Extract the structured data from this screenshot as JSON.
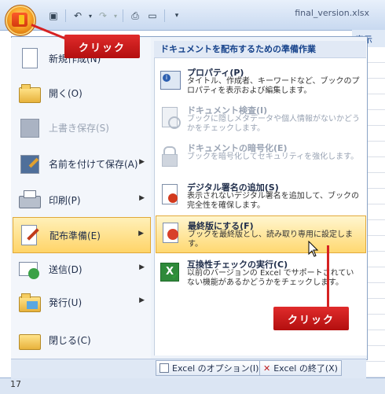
{
  "window": {
    "filename": "final_version.xlsx",
    "ribbon_tab_visible": "表示",
    "row_number": "17"
  },
  "left_menu": [
    {
      "label": "新規作成(N)",
      "icon": "new-document-icon",
      "has_arrow": false,
      "disabled": false
    },
    {
      "label": "開く(O)",
      "icon": "open-folder-icon",
      "has_arrow": false,
      "disabled": false
    },
    {
      "label": "上書き保存(S)",
      "icon": "save-icon",
      "has_arrow": false,
      "disabled": true
    },
    {
      "label": "名前を付けて保存(A)",
      "icon": "save-as-icon",
      "has_arrow": true,
      "disabled": false
    },
    {
      "label": "印刷(P)",
      "icon": "printer-icon",
      "has_arrow": true,
      "disabled": false
    },
    {
      "label": "配布準備(E)",
      "icon": "prepare-icon",
      "has_arrow": true,
      "disabled": false,
      "active": true
    },
    {
      "label": "送信(D)",
      "icon": "send-icon",
      "has_arrow": true,
      "disabled": false
    },
    {
      "label": "発行(U)",
      "icon": "publish-icon",
      "has_arrow": true,
      "disabled": false
    },
    {
      "label": "閉じる(C)",
      "icon": "close-folder-icon",
      "has_arrow": false,
      "disabled": false
    }
  ],
  "submenu": {
    "heading": "ドキュメントを配布するための準備作業",
    "items": [
      {
        "title": "プロパティ(P)",
        "desc": "タイトル、作成者、キーワードなど、ブックのプロパティを表示および編集します。",
        "icon": "properties-icon",
        "disabled": false
      },
      {
        "title": "ドキュメント検査(I)",
        "desc": "ブックに隠しメタデータや個人情報がないかどうかをチェックします。",
        "icon": "inspect-document-icon",
        "disabled": true
      },
      {
        "title": "ドキュメントの暗号化(E)",
        "desc": "ブックを暗号化してセキュリティを強化します。",
        "icon": "encrypt-lock-icon",
        "disabled": true
      },
      {
        "title": "デジタル署名の追加(S)",
        "desc": "表示されないデジタル署名を追加して、ブックの完全性を確保します。",
        "icon": "digital-signature-icon",
        "disabled": false
      },
      {
        "title": "最終版にする(F)",
        "desc": "ブックを最終版とし、読み取り専用に設定します。",
        "icon": "mark-final-icon",
        "disabled": false,
        "active": true
      },
      {
        "title": "互換性チェックの実行(C)",
        "desc": "以前のバージョンの Excel でサポートされていない機能があるかどうかをチェックします。",
        "icon": "compatibility-check-icon",
        "disabled": false
      }
    ]
  },
  "bottom_buttons": {
    "options": "Excel のオプション(I)",
    "exit": "Excel の終了(X)"
  },
  "callouts": {
    "top": "クリック",
    "bottom": "クリック"
  },
  "colors": {
    "callout_red": "#c8161d",
    "highlight": "#ffd468"
  }
}
